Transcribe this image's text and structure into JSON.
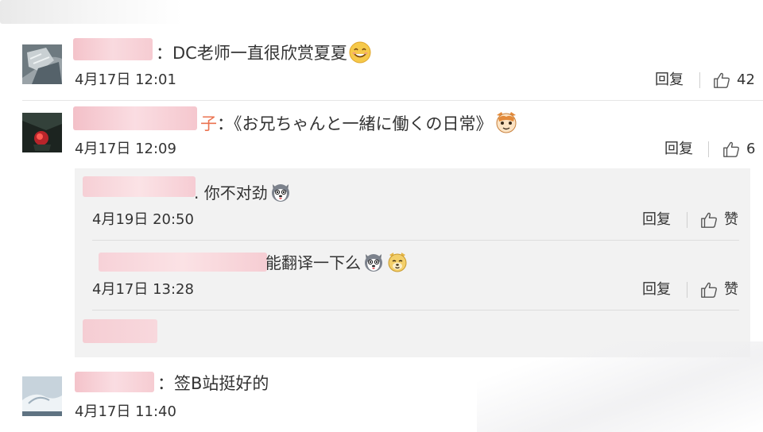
{
  "comments": [
    {
      "name_suffix": "",
      "text": "：DC老师一直很欣赏夏夏",
      "emoji": "smile-emoji",
      "time": "4月17日 12:01",
      "reply_label": "回复",
      "like_count": "42"
    },
    {
      "name_suffix": "子",
      "text": "：《お兄ちゃんと一緒に働くの日常》",
      "emoji": "cat-emoji",
      "time": "4月17日 12:09",
      "reply_label": "回复",
      "like_count": "6",
      "replies": [
        {
          "text": ". 你不对劲",
          "emoji": "husky-emoji",
          "time": "4月19日 20:50",
          "reply_label": "回复",
          "like_label": "赞"
        },
        {
          "text": "能翻译一下么",
          "emoji": "husky-doge-emoji",
          "time": "4月17日 13:28",
          "reply_label": "回复",
          "like_label": "赞"
        }
      ]
    },
    {
      "name_suffix": "",
      "text": "：签B站挺好的",
      "time": "4月17日 11:40"
    }
  ],
  "colors": {
    "redact_pink": "#f6c9cf",
    "reply_bg": "#f2f2f2",
    "text": "#333333",
    "name_orange": "#eb7350"
  }
}
